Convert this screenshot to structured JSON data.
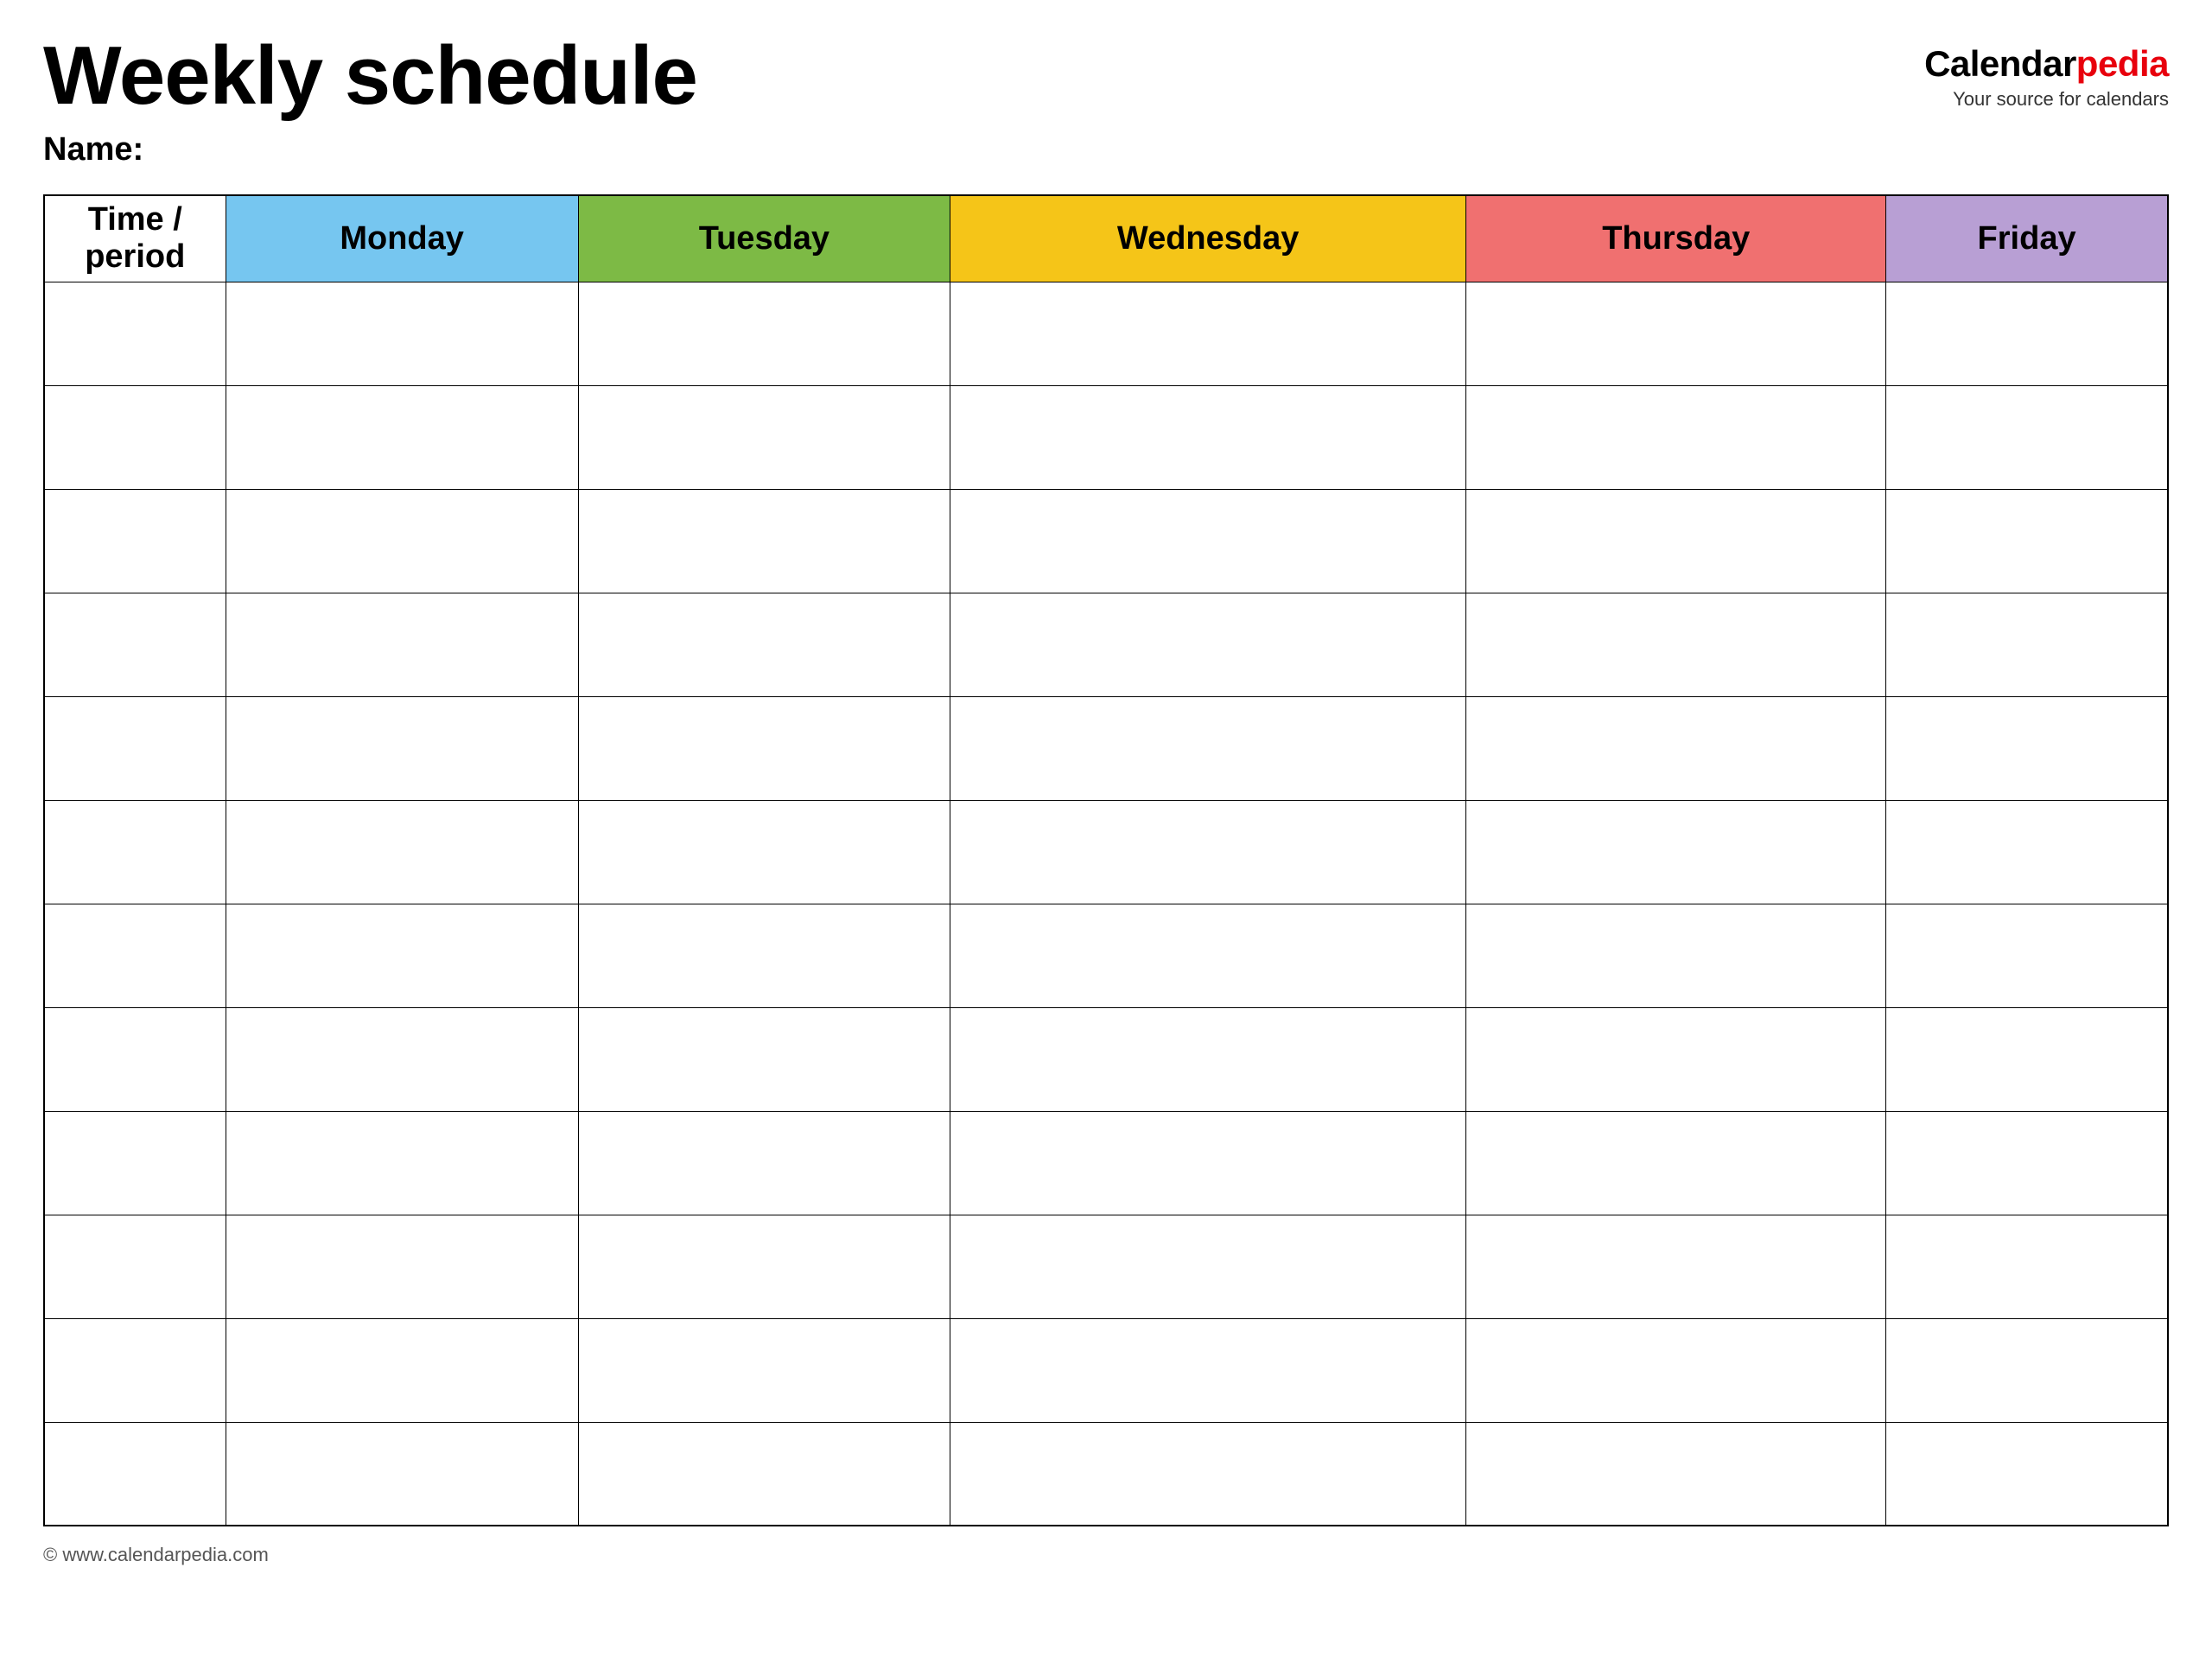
{
  "header": {
    "title": "Weekly schedule",
    "name_label": "Name:",
    "logo": {
      "calendar_part": "Calendar",
      "pedia_part": "pedia",
      "tagline": "Your source for calendars"
    }
  },
  "table": {
    "headers": {
      "time_period": "Time / period",
      "monday": "Monday",
      "tuesday": "Tuesday",
      "wednesday": "Wednesday",
      "thursday": "Thursday",
      "friday": "Friday"
    },
    "row_count": 12
  },
  "footer": {
    "url": "© www.calendarpedia.com"
  }
}
